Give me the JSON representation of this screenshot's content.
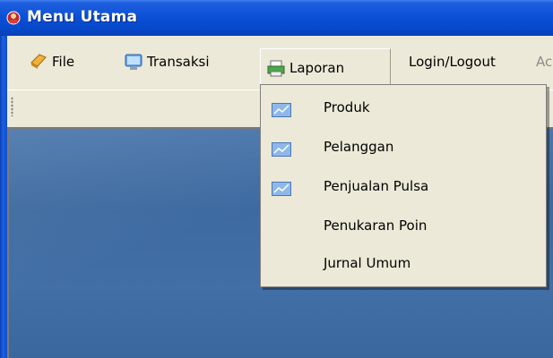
{
  "window": {
    "title": "Menu Utama"
  },
  "menubar": {
    "items": [
      {
        "label": "File",
        "icon": "file-icon"
      },
      {
        "label": "Transaksi",
        "icon": "monitor-icon"
      },
      {
        "label": "Laporan",
        "icon": "printer-icon"
      },
      {
        "label": "Login/Logout",
        "icon": ""
      },
      {
        "label": "Ac",
        "icon": ""
      }
    ],
    "open_menu": "Laporan"
  },
  "dropdown": {
    "items": [
      {
        "label": "Produk",
        "icon": "chart-icon"
      },
      {
        "label": "Pelanggan",
        "icon": "chart-icon"
      },
      {
        "label": "Penjualan Pulsa",
        "icon": "chart-icon"
      },
      {
        "label": "Penukaran Poin",
        "icon": ""
      },
      {
        "label": "Jurnal Umum",
        "icon": ""
      }
    ]
  },
  "colors": {
    "titlebar": "#0a4fd6",
    "menubar": "#ece9d8",
    "desktop": "#4a76ab"
  }
}
